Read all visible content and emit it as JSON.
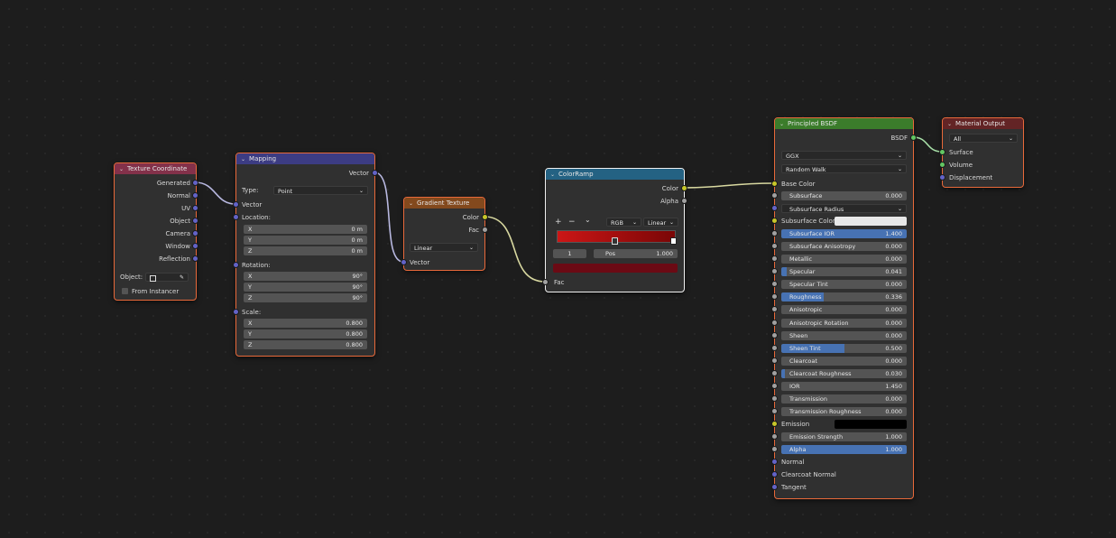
{
  "colors": {
    "input_header": "#83314a",
    "vector_header": "#3c3c83",
    "texture_header": "#83491d",
    "converter_header": "#246283",
    "shader_header": "#3b7c2b",
    "output_header": "#632425",
    "vector_socket": "#6363c7",
    "color_socket": "#c7c729",
    "float_socket": "#a1a1a1",
    "shader_socket": "#63c763"
  },
  "texcoord": {
    "title": "Texture Coordinate",
    "outputs": [
      "Generated",
      "Normal",
      "UV",
      "Object",
      "Camera",
      "Window",
      "Reflection"
    ],
    "object_label": "Object:",
    "from_instancer": "From Instancer"
  },
  "mapping": {
    "title": "Mapping",
    "out_vector": "Vector",
    "type_label": "Type:",
    "type_value": "Point",
    "in_vector": "Vector",
    "location": "Location:",
    "loc": [
      {
        "k": "X",
        "v": "0 m"
      },
      {
        "k": "Y",
        "v": "0 m"
      },
      {
        "k": "Z",
        "v": "0 m"
      }
    ],
    "rotation": "Rotation:",
    "rot": [
      {
        "k": "X",
        "v": "90°"
      },
      {
        "k": "Y",
        "v": "90°"
      },
      {
        "k": "Z",
        "v": "90°"
      }
    ],
    "scale": "Scale:",
    "scl": [
      {
        "k": "X",
        "v": "0.800"
      },
      {
        "k": "Y",
        "v": "0.800"
      },
      {
        "k": "Z",
        "v": "0.800"
      }
    ]
  },
  "gradient": {
    "title": "Gradient Texture",
    "out_color": "Color",
    "out_fac": "Fac",
    "type": "Linear",
    "in_vector": "Vector"
  },
  "colorramp": {
    "title": "ColorRamp",
    "out_color": "Color",
    "out_alpha": "Alpha",
    "add": "+",
    "remove": "−",
    "menu": "⌄",
    "mode": "RGB",
    "interp": "Linear",
    "index": "1",
    "pos_label": "Pos",
    "pos_value": "1.000",
    "in_fac": "Fac",
    "ramp_left": "#cc1616",
    "ramp_right": "#7a0606",
    "stop_color": "#6b0a14"
  },
  "bsdf": {
    "title": "Principled BSDF",
    "out": "BSDF",
    "distribution": "GGX",
    "subsurface_method": "Random Walk",
    "base_color_label": "Base Color",
    "rows": [
      {
        "label": "Subsurface",
        "value": "0.000",
        "fill": 0
      },
      {
        "label": "Subsurface Radius",
        "value": "",
        "fill": 0,
        "dropdown": true
      },
      {
        "label": "Subsurface Color",
        "value": "",
        "fill": 0,
        "swatch": "#e8e8e8"
      },
      {
        "label": "Subsurface IOR",
        "value": "1.400",
        "fill": 1
      },
      {
        "label": "Subsurface Anisotropy",
        "value": "0.000",
        "fill": 0
      },
      {
        "label": "Metallic",
        "value": "0.000",
        "fill": 0
      },
      {
        "label": "Specular",
        "value": "0.041",
        "fill": 0.041
      },
      {
        "label": "Specular Tint",
        "value": "0.000",
        "fill": 0
      },
      {
        "label": "Roughness",
        "value": "0.336",
        "fill": 0.336
      },
      {
        "label": "Anisotropic",
        "value": "0.000",
        "fill": 0
      },
      {
        "label": "Anisotropic Rotation",
        "value": "0.000",
        "fill": 0
      },
      {
        "label": "Sheen",
        "value": "0.000",
        "fill": 0
      },
      {
        "label": "Sheen Tint",
        "value": "0.500",
        "fill": 0.5
      },
      {
        "label": "Clearcoat",
        "value": "0.000",
        "fill": 0
      },
      {
        "label": "Clearcoat Roughness",
        "value": "0.030",
        "fill": 0.03
      },
      {
        "label": "IOR",
        "value": "1.450",
        "fill": 0
      },
      {
        "label": "Transmission",
        "value": "0.000",
        "fill": 0
      },
      {
        "label": "Transmission Roughness",
        "value": "0.000",
        "fill": 0
      },
      {
        "label": "Emission",
        "value": "",
        "fill": 0,
        "swatch": "#000000"
      },
      {
        "label": "Emission Strength",
        "value": "1.000",
        "fill": 0
      },
      {
        "label": "Alpha",
        "value": "1.000",
        "fill": 1
      },
      {
        "label": "Normal",
        "value": "",
        "fill": 0,
        "plain": true
      },
      {
        "label": "Clearcoat Normal",
        "value": "",
        "fill": 0,
        "plain": true
      },
      {
        "label": "Tangent",
        "value": "",
        "fill": 0,
        "plain": true
      }
    ]
  },
  "output": {
    "title": "Material Output",
    "target": "All",
    "inputs": [
      "Surface",
      "Volume",
      "Displacement"
    ]
  }
}
